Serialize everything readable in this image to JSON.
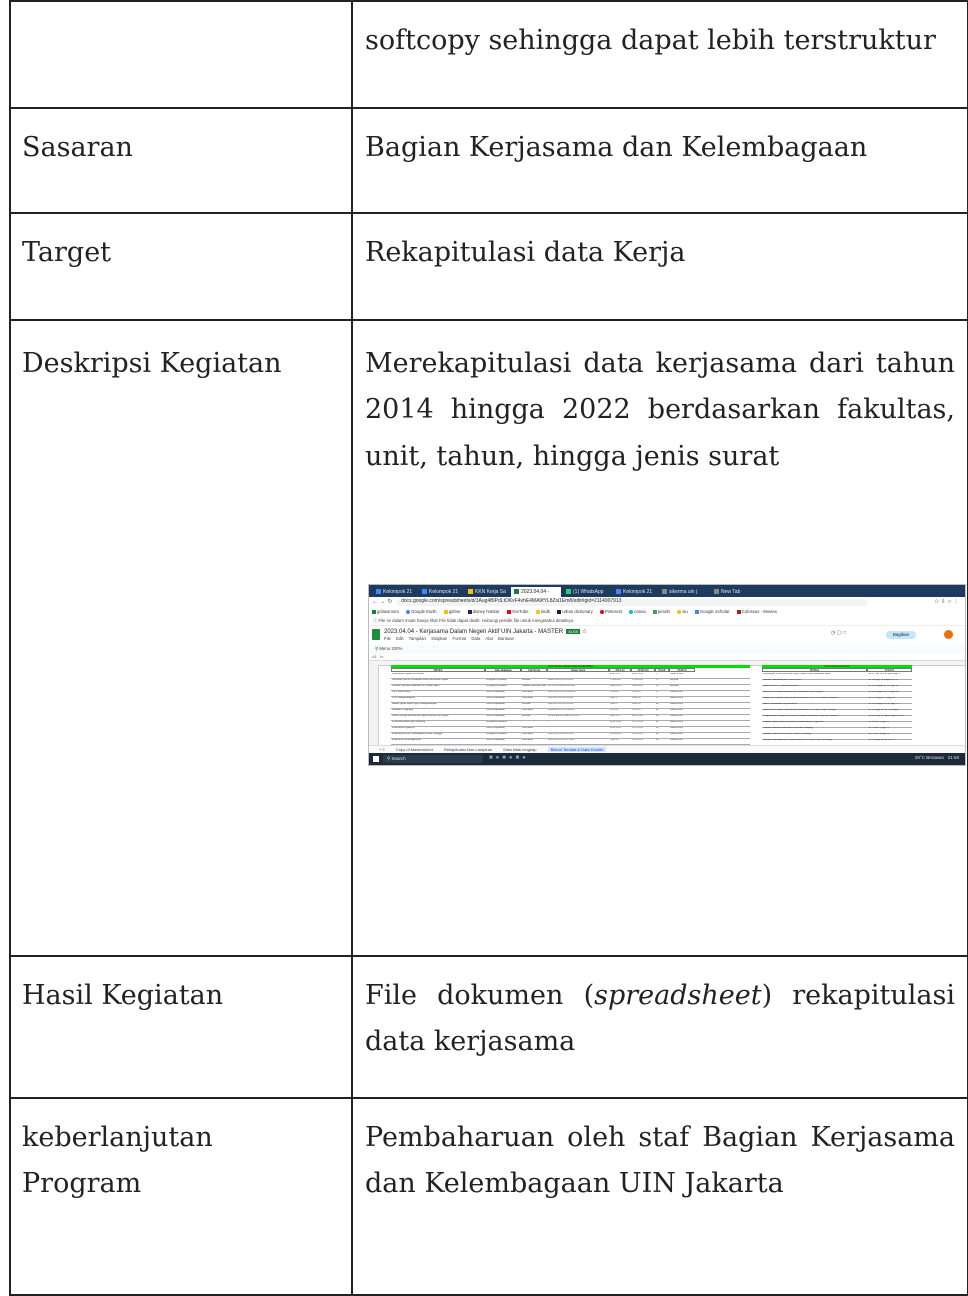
{
  "rows": [
    {
      "label": "",
      "value": "softcopy sehingga dapat lebih terstruktur"
    },
    {
      "label": "Sasaran",
      "value": "Bagian Kerjasama dan Kelembagaan"
    },
    {
      "label": "Target",
      "value": "Rekapitulasi data Kerja"
    },
    {
      "label": "Deskripsi Kegiatan",
      "value": "Merekapitulasi data kerjasama dari tahun 2014 hingga 2022 berdasarkan fakultas, unit, tahun, hingga jenis surat"
    },
    {
      "label": "Hasil Kegiatan",
      "value_before": "File dokumen (",
      "value_italic": "spreadsheet",
      "value_after": ") rekapitulasi data kerjasama"
    },
    {
      "label": "keberlanjutan Program",
      "value": "Pembaharuan oleh staf Bagian Kerjasama dan Kelembagaan UIN Jakarta"
    }
  ],
  "screenshot": {
    "tabs": [
      "Kelompok 21",
      "Kelompok 21",
      "KKN Kerja Sa",
      "2023.04.04 -",
      "(1) WhatsApp",
      "Kelompok 21",
      "sikerma uin j",
      "New Tab"
    ],
    "url": "docs.google.com/spreadsheets/d/1Aug4BlPdLtOKvF4vhE4MA9fYL8Zsl1Em8/edit#gid=2114007913",
    "bookmarks": [
      "gclassroom",
      "Google Earth",
      "gdrive",
      "disney hotstar",
      "YouTube",
      "imdb",
      "urban dictionary",
      "Pinterest",
      "canva",
      "perafo",
      "viu",
      "Google Scholar",
      "Colossus - Movies"
    ],
    "info_text": "File ini dalam mode hanya lihat  File tidak dapat diedit. Hubungi pemilik file untuk mengetahui detailnya.",
    "doc_title": "2023.04.04 - Kerjasama Dalam Negeri Aktif UIN Jakarta - MASTER",
    "doc_badge": "XLSX",
    "menu": [
      "File",
      "Edit",
      "Tampilan",
      "Sisipkan",
      "Format",
      "Data",
      "Alat",
      "Bantuan"
    ],
    "share_label": "Bagikan",
    "toolbar_text": "Menu   100%",
    "cell_ref": "A1",
    "sheet_title": "MOA DI SIS, TIDAK ADA DI SIKERMA",
    "double_title": "DATA YANG DOUBLE",
    "headers": [
      "MITRA",
      "Jenis Dokumen",
      "Unit Kerja",
      "Nomor Surat",
      "MULAI",
      "SELESAI",
      "PAGE",
      "STATUS"
    ],
    "double_headers": [
      "MITRA",
      "STATUS"
    ],
    "grid_rows": [
      [
        "Kementerian Agama DKI Jakarta",
        "",
        "",
        "",
        "06/07/2017",
        "06/07/2018",
        "5",
        "Sudah selesai"
      ],
      [
        "Direktorat Jenderal Pendidikan Islam Kementerian Agama",
        "Perjanjian Kerjasama",
        "Rektorat",
        "B-4965/R/OT.01.6/9/2022",
        "27/09/2022",
        "27/09/2026",
        "13",
        "Berjalan"
      ],
      [
        "Fakultas Adab dan Humaniora UIN Sunan Ampel",
        "Perjanjian Kerjasama",
        "Fakultas Adab dan Humaniora",
        "B-575/F.2/HK.00.3/02/2020",
        "14/02/2020",
        "14/02/2026",
        "20",
        "Berjalan"
      ],
      [
        "IAIN Sunan Bonjol",
        "Nota Kesepahaman",
        "Universitas",
        "Un.01/R/OT.01.6/3298/2016",
        "10/10/16",
        "10/10/19",
        "37",
        "Sudah selesai"
      ],
      [
        "IAIN Padangsidimpuan",
        "Nota Kesepahaman",
        "Universitas",
        "Un.01/R/OT.01.6/128/2017",
        "30/01/17",
        "30/01/20",
        "37",
        "Sudah selesai"
      ],
      [
        "Institut Agama Islam Negeri Padangsidimpuan",
        "Nota Kesepahaman",
        "Rektorat",
        "Un.01/R/OT.01.6/128/2017",
        "30/01/17",
        "30/01/20",
        "40",
        "Sudah selesai"
      ],
      [
        "Kabupaten Tangerang",
        "Nota Kesepahaman",
        "Universitas",
        "B-2642/R/OT.01.6/IX/2016",
        "25/12/16",
        "25/12/19",
        "46",
        "Sudah selesai"
      ],
      [
        "Kantor Wilayah Kementerian Agama Provinsi DKI Jakarta",
        "Nota Kesepahaman",
        "Rektorat",
        "B-7803/Kw.09.2/HM.01/05/2017",
        "06/07/2017",
        "06/07/2020",
        "46",
        "Sudah selesai"
      ],
      [
        "Kelurahan Bambu Apus Pamulang",
        "Perjanjian Kerjasama",
        "",
        "-",
        "01/01/2014",
        "31/12/2019",
        "48",
        "Sudah selesai"
      ],
      [
        "Kementerian Agama RI",
        "Nota Kesepahaman",
        "Universitas",
        "-",
        "01/01/2015",
        "31/12/2019",
        "49",
        "Sudah selesai"
      ],
      [
        "Kementerian Desa, Pembangunan Daerah Tertinggal",
        "Perjanjian Kerjasama",
        "Universitas",
        "Un.01/R/OT.01.6/IX/2016",
        "21/03/2016",
        "21/03/2019",
        "49",
        "Sudah selesai"
      ],
      [
        "Kementerian Ketenagakerjaan",
        "Nota Kesepahaman",
        "Universitas",
        "Un.01/R/OT.01.6/417/2016",
        "25/01/16",
        "25/01/2019",
        "49",
        "Sudah selesai"
      ]
    ],
    "double_rows": [
      [
        "Pascasarjana Universitas Islam Negeri Sultan Thaha Syaifuddin Jambi",
        "No 237 dan No 238 sama Page 67"
      ],
      [
        "Fakultas Ushuluddin dan Dakwah Bone",
        "No 110 page 30 dengan No 113"
      ],
      [
        "Jurusan KPI UIN Alauddin Makassar",
        "No 161 dengan No 162 page 42"
      ],
      [
        "Jurusan MD Fakultas Dakwah dan Komunikasi IAIN Parepare",
        "No 169 dengan No 172 page 44"
      ],
      [
        "Jurusan MD Fakultas Dakwah dan Komunikasi IAIN UIN Alauddin Makassar",
        "No 172 dengan 173 page 44"
      ],
      [
        "Ikatan Persaudaraan Haji Indonesia",
        "No 243 dengan No 247 page 70"
      ],
      [
        "Jurusan MD Fakultas Dakwah dan Komunikasi UIN Sunan Ampel Surabaya",
        "No 165 page 44 No 376 dengan"
      ],
      [
        "Program Studi Manajemen Dakwah Fakultas Ushuluddin, Adab, Dan Dakwah",
        "No 304 Page 83 sama dengan No 305"
      ],
      [
        "Fakultas Agama Islam Universitas Muhammadiyah Yogyakarta",
        "No 58 dan 59 page 21"
      ],
      [
        "Fakultas Ekonomi Dan Bisnis Universitas Lampung",
        "No 70 dan 71 page 23"
      ],
      [
        "Fakultas Ekonomi Universitas Trisakti Palembang",
        "No 73 dan 74 page 24"
      ],
      [
        "Fakultas Ushuluddin dan Pemikiran Islam UIN Raden Fatah Palembang",
        "No 126 page 34 dan No 127"
      ]
    ],
    "sheet_tabs": [
      "Copy of Mastersheet",
      "Rekapitulasi Non-Lampiran",
      "Data tidak lengkap",
      "Belum Terdata & Data Double"
    ],
    "active_sheet": "Belum Terdata & Data Double",
    "search_label": "Search",
    "weather": "28°C Berawan",
    "clock": "21:58"
  }
}
